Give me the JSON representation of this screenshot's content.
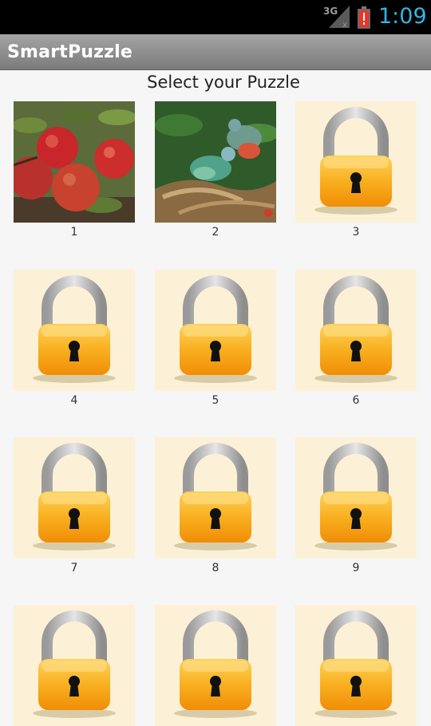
{
  "status_bar": {
    "network": "3G",
    "time": "1:09",
    "signal_icon": "signal-icon",
    "battery_icon": "battery-alert-icon"
  },
  "app_bar": {
    "title": "SmartPuzzle"
  },
  "page": {
    "heading": "Select your Puzzle"
  },
  "puzzles": [
    {
      "label": "1",
      "image": "apples-photo",
      "locked": false
    },
    {
      "label": "2",
      "image": "birds-photo",
      "locked": false
    },
    {
      "label": "3",
      "image": "padlock-icon",
      "locked": true
    },
    {
      "label": "4",
      "image": "padlock-icon",
      "locked": true
    },
    {
      "label": "5",
      "image": "padlock-icon",
      "locked": true
    },
    {
      "label": "6",
      "image": "padlock-icon",
      "locked": true
    },
    {
      "label": "7",
      "image": "padlock-icon",
      "locked": true
    },
    {
      "label": "8",
      "image": "padlock-icon",
      "locked": true
    },
    {
      "label": "9",
      "image": "padlock-icon",
      "locked": true
    },
    {
      "label": "",
      "image": "padlock-icon",
      "locked": true
    },
    {
      "label": "",
      "image": "padlock-icon",
      "locked": true
    },
    {
      "label": "",
      "image": "padlock-icon",
      "locked": true
    }
  ],
  "colors": {
    "status_time": "#33b5e5",
    "tile_background": "#fcf1d6",
    "lock_body": "#f6a10f",
    "app_bar": "#8e8e8e"
  }
}
